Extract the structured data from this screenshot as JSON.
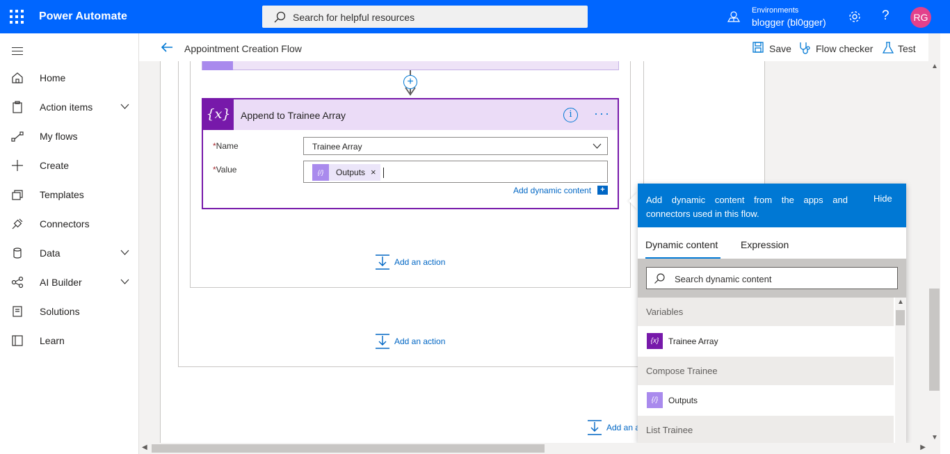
{
  "app": {
    "title": "Power Automate"
  },
  "search": {
    "placeholder": "Search for helpful resources"
  },
  "environment": {
    "label": "Environments",
    "value": "blogger (bl0gger)"
  },
  "help": {
    "glyph": "?"
  },
  "user": {
    "initials": "RG",
    "color": "#e3418b"
  },
  "colors": {
    "brand": "#0066ff",
    "accent": "#0078d4",
    "variable": "#7719aa"
  },
  "sidebar": {
    "items": [
      {
        "label": "Home",
        "icon": "home-icon"
      },
      {
        "label": "Action items",
        "icon": "clipboard-icon",
        "expandable": true
      },
      {
        "label": "My flows",
        "icon": "flow-icon"
      },
      {
        "label": "Create",
        "icon": "plus-icon"
      },
      {
        "label": "Templates",
        "icon": "templates-icon"
      },
      {
        "label": "Connectors",
        "icon": "connector-icon"
      },
      {
        "label": "Data",
        "icon": "database-icon",
        "expandable": true
      },
      {
        "label": "AI Builder",
        "icon": "ai-builder-icon",
        "expandable": true
      },
      {
        "label": "Solutions",
        "icon": "solutions-icon"
      },
      {
        "label": "Learn",
        "icon": "book-icon"
      }
    ]
  },
  "header": {
    "flow_title": "Appointment Creation Flow",
    "save_label": "Save",
    "checker_label": "Flow checker",
    "test_label": "Test"
  },
  "action_card": {
    "icon_glyph": "{x}",
    "title": "Append to Trainee Array",
    "info_glyph": "i",
    "more_glyph": "···",
    "required_mark": "*",
    "name_label": "Name",
    "name_value": "Trainee Array",
    "value_label": "Value",
    "token_glyph": "{/}",
    "token_label": "Outputs",
    "token_remove": "×",
    "add_dynamic_label": "Add dynamic content",
    "add_dynamic_glyph": "+"
  },
  "add_action_label": "Add an action",
  "add_action_label_partial": "Add an a",
  "dynamic_panel": {
    "description": "Add dynamic content from the apps and connectors used in this flow.",
    "hide_label": "Hide",
    "tabs": [
      "Dynamic content",
      "Expression"
    ],
    "search_placeholder": "Search dynamic content",
    "groups": [
      {
        "label": "Variables",
        "option": {
          "label": "Trainee Array",
          "glyph": "{x}"
        }
      },
      {
        "label": "Compose Trainee",
        "option": {
          "label": "Outputs",
          "glyph": "{/}"
        }
      },
      {
        "label": "List Trainee"
      }
    ]
  }
}
